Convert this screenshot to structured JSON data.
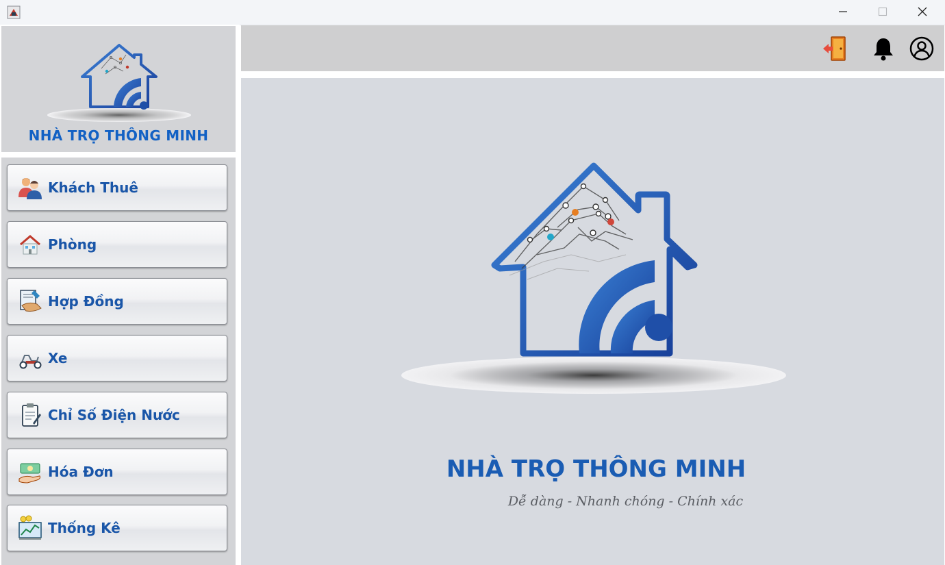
{
  "window": {
    "minimize_icon": "minimize-icon",
    "maximize_icon": "maximize-icon",
    "close_icon": "close-icon"
  },
  "sidebar": {
    "brand": "NHÀ TRỌ THÔNG MINH",
    "items": [
      {
        "label": "Khách Thuê",
        "icon": "tenants-icon"
      },
      {
        "label": "Phòng",
        "icon": "room-icon"
      },
      {
        "label": "Hợp Đồng",
        "icon": "contract-icon"
      },
      {
        "label": "Xe",
        "icon": "scooter-icon"
      },
      {
        "label": "Chỉ Số Điện Nước",
        "icon": "meter-clipboard-icon"
      },
      {
        "label": "Hóa Đơn",
        "icon": "money-icon"
      },
      {
        "label": "Thống Kê",
        "icon": "statistics-icon"
      }
    ]
  },
  "topbar": {
    "icons": [
      "logout-icon",
      "bell-icon",
      "user-icon"
    ]
  },
  "main": {
    "brand": "NHÀ TRỌ THÔNG MINH",
    "slogan": "Dễ dàng - Nhanh chóng - Chính xác"
  },
  "colors": {
    "brand_blue": "#1261c4",
    "panel_gray": "#d3d4d7",
    "main_bg": "#d7dae0"
  }
}
